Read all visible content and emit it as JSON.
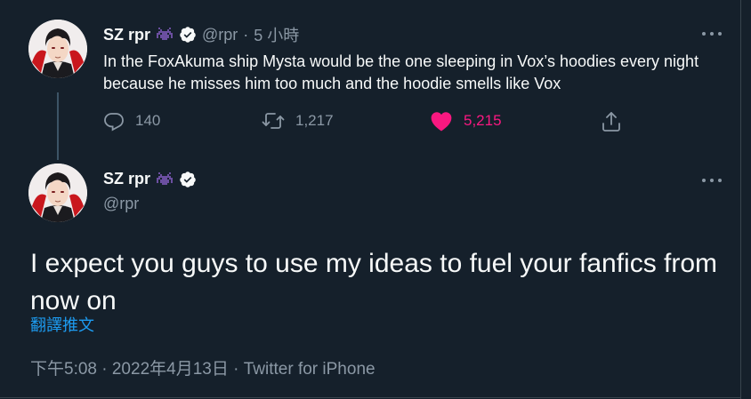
{
  "colors": {
    "background": "#15202b",
    "text": "#f7f9f9",
    "muted": "#8b98a5",
    "link": "#1d9bf0",
    "like": "#f91880",
    "verified": "#f7f9f9",
    "emoji_purple": "#6b4fa0"
  },
  "first_tweet": {
    "name": "SZ rpr",
    "handle": "@rpr",
    "separator": "·",
    "time": "5 小時",
    "text": "In the FoxAkuma ship Mysta would be the one sleeping in Vox’s hoodies every night because he misses him too much and the hoodie smells like Vox",
    "icons": {
      "avatar": "avatar-image",
      "emoji": "space-invader-emoji-icon",
      "verified": "verified-badge-icon",
      "more": "more-options-icon"
    },
    "actions": {
      "reply": {
        "icon": "reply-icon",
        "count": "140"
      },
      "retweet": {
        "icon": "retweet-icon",
        "count": "1,217"
      },
      "like": {
        "icon": "heart-filled-icon",
        "count": "5,215",
        "liked": true
      },
      "share": {
        "icon": "share-icon"
      }
    }
  },
  "main_tweet": {
    "name": "SZ rpr",
    "handle": "@rpr",
    "text": "I expect you guys to use my ideas to fuel your fanfics from now on",
    "translate_label": "翻譯推文",
    "timestamp": "下午5:08 · 2022年4月13日",
    "meta_separator": "·",
    "source": "Twitter for iPhone"
  }
}
